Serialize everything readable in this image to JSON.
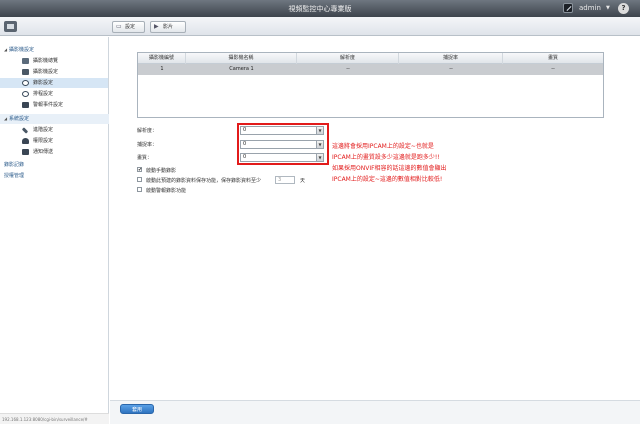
{
  "window": {
    "title": "視頻監控中心專業版",
    "user": "admin",
    "help": "?"
  },
  "toolbar": {
    "settings_label": "設定",
    "play_label": "影片"
  },
  "sidebar": {
    "group1": "攝影機設定",
    "group1_items": [
      {
        "label": "攝影機總覽",
        "icon": "camera-list-icon"
      },
      {
        "label": "攝影機設定",
        "icon": "camera-settings-icon"
      },
      {
        "label": "錄影設定",
        "icon": "record-settings-icon"
      },
      {
        "label": "排程設定",
        "icon": "schedule-icon"
      },
      {
        "label": "警報事件設定",
        "icon": "alarm-icon"
      }
    ],
    "group2": "系統設定",
    "group2_items": [
      {
        "label": "進階設定",
        "icon": "wrench-icon"
      },
      {
        "label": "權限設定",
        "icon": "user-permission-icon"
      },
      {
        "label": "通知傳送",
        "icon": "network-icon"
      }
    ],
    "link1": "錄影記錄",
    "link2": "授權管理",
    "status_url": "192.168.1.123:8080/cgi-bin/surveillance/#"
  },
  "table": {
    "headers": [
      "攝影機編號",
      "攝影機名稱",
      "解析度",
      "捕捉率",
      "畫質"
    ],
    "row": [
      "1",
      "Camera 1",
      "--",
      "--",
      "--"
    ]
  },
  "form": {
    "resolution_label": "解析度：",
    "framerate_label": "捕捉率：",
    "quality_label": "畫質：",
    "resolution_value": "0",
    "framerate_value": "0",
    "quality_value": "0",
    "manual_record_label": "啟動手動錄影",
    "auto_delete_label": "啟動此預建的錄影資料保存功能，保存錄影資料至少",
    "days_placeholder": "3",
    "days_unit": "天",
    "alarm_record_label": "啟動警報錄影功能",
    "manual_record_checked": "✔"
  },
  "annotations": [
    "這邊將會採用IPCAM上的設定~也就是",
    "IPCAM上的畫質設多少這邊就是跑多少!!",
    "如果採用ONVIF相容的話這邊的數值會顯出",
    "IPCAM上的設定~這邊的數值相對比較低!"
  ],
  "footer": {
    "apply_label": "套用"
  },
  "colors": {
    "annotation": "#e21b1b",
    "accent": "#2f74c0"
  }
}
